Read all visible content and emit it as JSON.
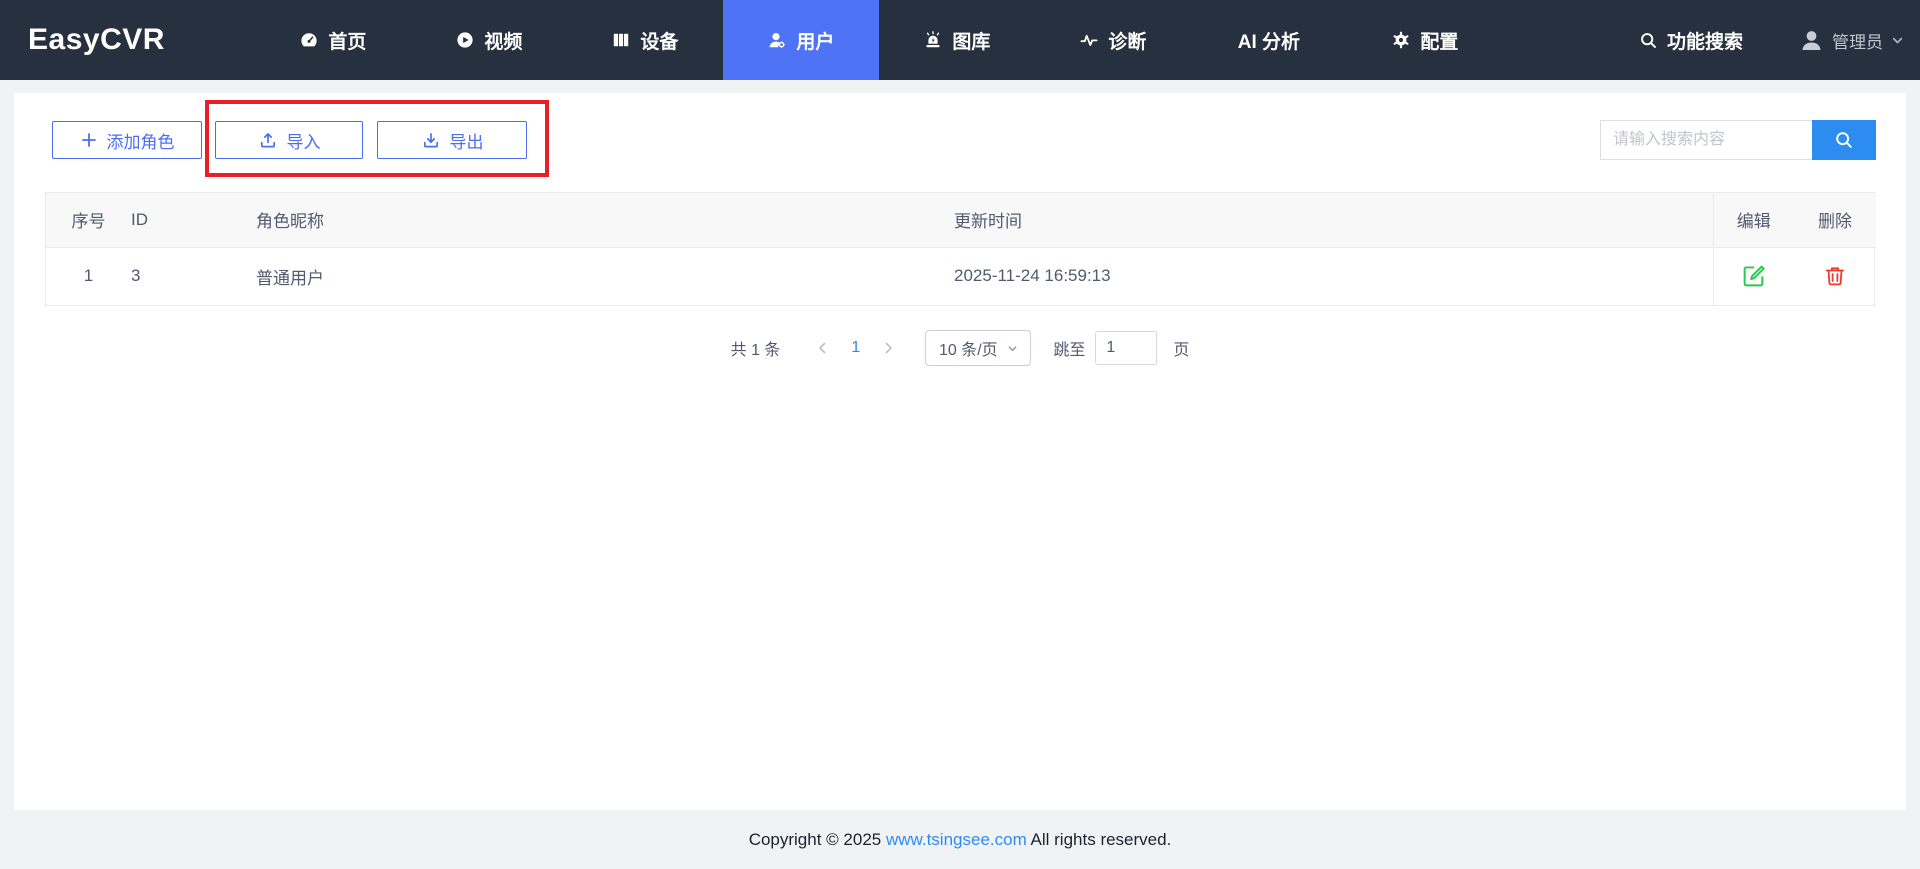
{
  "brand": {
    "logo": "EasyCVR"
  },
  "nav": {
    "items": [
      {
        "label": "首页",
        "icon": "dashboard-icon",
        "active": false
      },
      {
        "label": "视频",
        "icon": "video-icon",
        "active": false
      },
      {
        "label": "设备",
        "icon": "device-icon",
        "active": false
      },
      {
        "label": "用户",
        "icon": "user-icon",
        "active": true
      },
      {
        "label": "图库",
        "icon": "alarm-icon",
        "active": false
      },
      {
        "label": "诊断",
        "icon": "pulse-icon",
        "active": false
      },
      {
        "label": "AI 分析",
        "icon": null,
        "active": false
      },
      {
        "label": "配置",
        "icon": "gear-icon",
        "active": false
      }
    ],
    "function_search": "功能搜索",
    "admin": "管理员"
  },
  "toolbar": {
    "add_role_label": "添加角色",
    "import_label": "导入",
    "export_label": "导出",
    "search_placeholder": "请输入搜索内容"
  },
  "table": {
    "headers": {
      "index": "序号",
      "id": "ID",
      "role_name": "角色昵称",
      "updated_at": "更新时间",
      "edit": "编辑",
      "delete": "删除"
    },
    "rows": [
      {
        "index": "1",
        "id": "3",
        "role_name": "普通用户",
        "updated_at": "2025-11-24 16:59:13"
      }
    ]
  },
  "pagination": {
    "total_label": "共 1 条",
    "current_page": "1",
    "page_size_label": "10 条/页",
    "jump_label": "跳至",
    "jump_value": "1",
    "page_unit": "页"
  },
  "footer": {
    "prefix": "Copyright © 2025 ",
    "link": "www.tsingsee.com",
    "suffix": " All rights reserved."
  },
  "colors": {
    "navbar_bg": "#27303f",
    "nav_active_bg": "#4e73f5",
    "button_blue": "#4c6df2",
    "search_button_blue": "#2d8cf0",
    "link_blue": "#2d8cf0",
    "edit_green": "#2bc84e",
    "delete_red": "#f0392e",
    "annotation_red": "#e81f27"
  }
}
